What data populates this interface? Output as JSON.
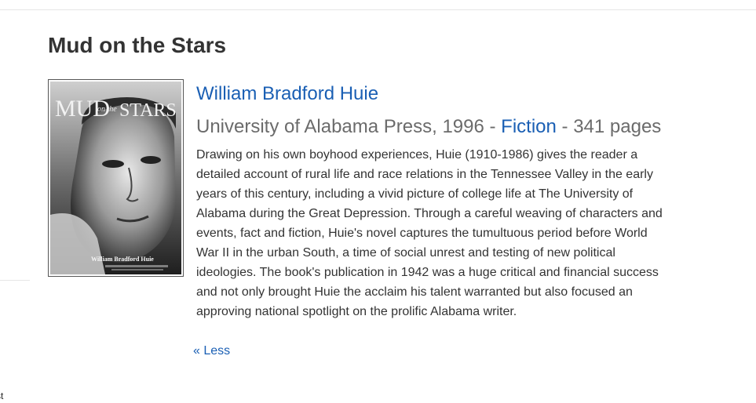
{
  "book": {
    "title": "Mud on the Stars",
    "author": "William Bradford Huie",
    "publisher_year": "University of Alabama Press, 1996 - ",
    "genre": "Fiction",
    "pages": " - 341 pages",
    "description": "Drawing on his own boyhood experiences, Huie (1910-1986) gives the reader a detailed account of rural life and race relations in the Tennessee Valley in the early years of this century, including a vivid picture of college life at The University of Alabama during the Great Depression. Through a careful weaving of characters and events, fact and fiction, Huie's novel captures the tumultuous period before World War II in the urban South, a time of social unrest and testing of new political ideologies. The book's publication in 1942 was a huge critical and financial success and not only brought Huie the acclaim his talent warranted but also focused an approving national spotlight on the prolific Alabama writer.",
    "less_label": "« Less"
  },
  "cover": {
    "title_word_1": "MUD",
    "title_word_2": "on the",
    "title_word_3": "STARS",
    "author_line": "William Bradford Huie"
  },
  "corner_text": "st",
  "colors": {
    "link": "#1a5fb4",
    "meta_gray": "#6b6b6b",
    "title": "#333333"
  }
}
